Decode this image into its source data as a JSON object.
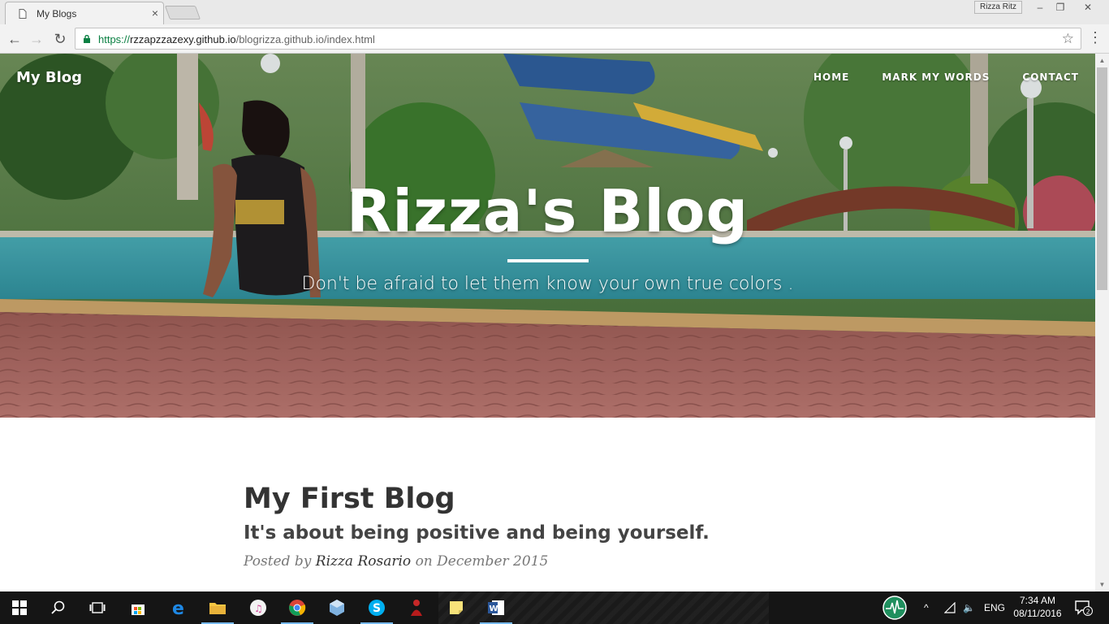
{
  "browser": {
    "tab_title": "My Blogs",
    "tab_close": "×",
    "profile_name": "Rizza Ritz",
    "url_scheme": "https://",
    "url_host": "rzzapzzazexy.github.io",
    "url_path": "/blogrizza.github.io/index.html",
    "win_minimize": "–",
    "win_restore": "❐",
    "win_close": "✕",
    "back": "←",
    "forward": "→",
    "reload": "↻",
    "star": "☆",
    "menu": "⋮"
  },
  "site": {
    "brand": "My Blog",
    "nav": [
      "HOME",
      "MARK MY WORDS",
      "CONTACT"
    ],
    "hero_title": "Rizza's Blog",
    "hero_subtitle": "Don't be afraid to let them know your own true colors ."
  },
  "post": {
    "title": "My First Blog",
    "subtitle": "It's about being positive and being yourself.",
    "meta_prefix": "Posted by ",
    "author": "Rizza Rosario",
    "meta_suffix": " on December 2015"
  },
  "taskbar": {
    "lang": "ENG",
    "time": "7:34 AM",
    "date": "08/11/2016",
    "notifications": "2"
  },
  "colors": {
    "url_green": "#0b8043",
    "taskbar": "#151515",
    "accent": "#76b9ed"
  }
}
